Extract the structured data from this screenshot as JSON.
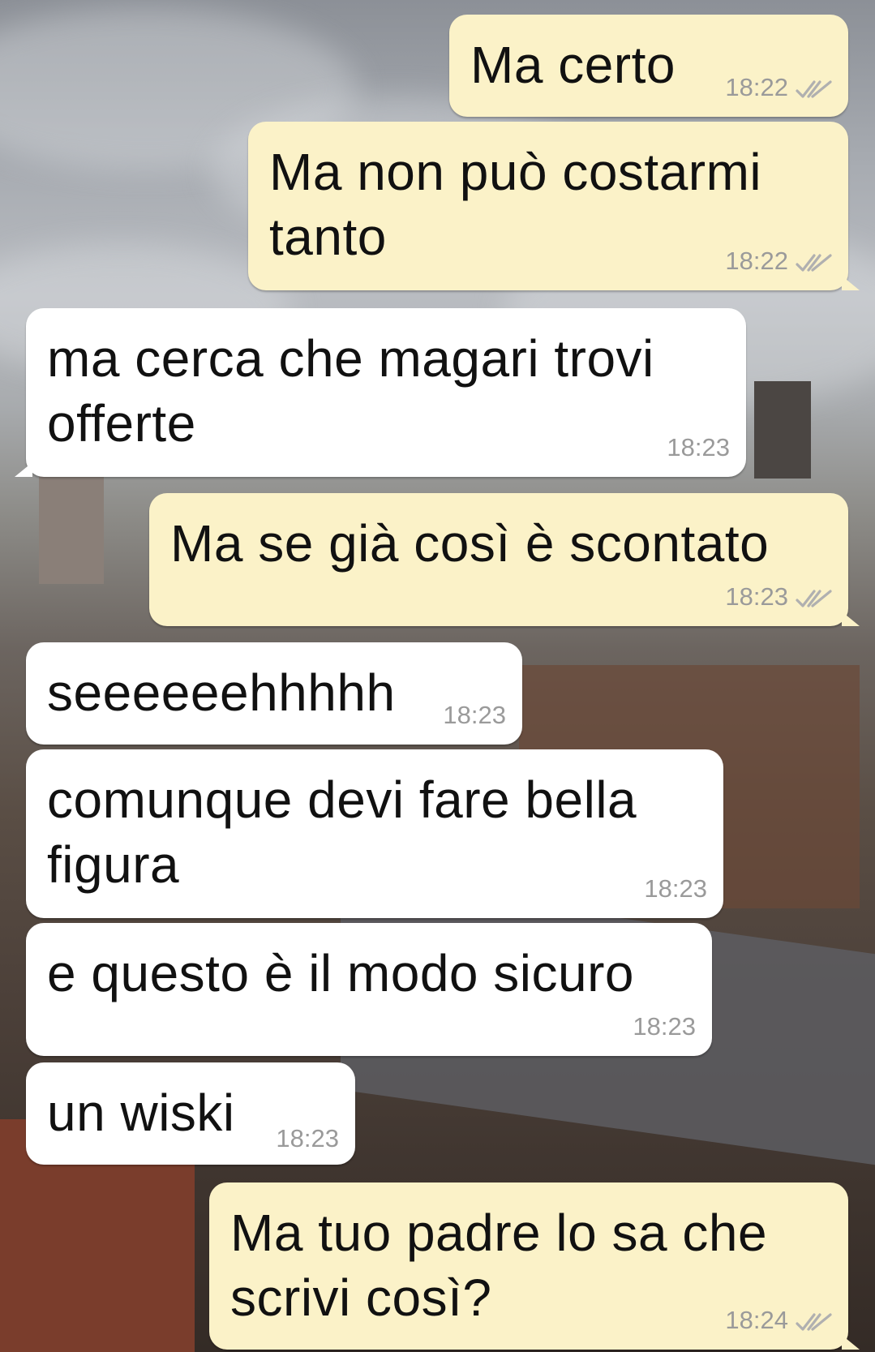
{
  "chat": {
    "messages": [
      {
        "direction": "outgoing",
        "text": [
          "Ma certo"
        ],
        "time": "18:22",
        "status": "read-double-check"
      },
      {
        "direction": "outgoing",
        "text": [
          "Ma non può costarmi",
          "tanto"
        ],
        "time": "18:22",
        "status": "read-double-check"
      },
      {
        "direction": "incoming",
        "text": [
          "ma cerca che magari trovi",
          "offerte"
        ],
        "time": "18:23"
      },
      {
        "direction": "outgoing",
        "text": [
          "Ma se già così è scontato"
        ],
        "time": "18:23",
        "status": "read-double-check"
      },
      {
        "direction": "incoming",
        "text": [
          "seeeeeehhhhh"
        ],
        "time": "18:23"
      },
      {
        "direction": "incoming",
        "text": [
          "comunque devi fare bella",
          "figura"
        ],
        "time": "18:23"
      },
      {
        "direction": "incoming",
        "text": [
          "e questo è il modo sicuro"
        ],
        "time": "18:23"
      },
      {
        "direction": "incoming",
        "text": [
          "un wiski"
        ],
        "time": "18:23"
      },
      {
        "direction": "outgoing",
        "text": [
          "Ma tuo padre lo sa che",
          "scrivi così?"
        ],
        "time": "18:24",
        "status": "read-double-check"
      }
    ]
  },
  "colors": {
    "outgoing_bubble": "#fbf2c8",
    "incoming_bubble": "#ffffff",
    "timestamp": "#9a9a9a",
    "check_icon": "#b0b0b0"
  },
  "background": {
    "description_icon": "wallpaper-city-rooftops"
  }
}
